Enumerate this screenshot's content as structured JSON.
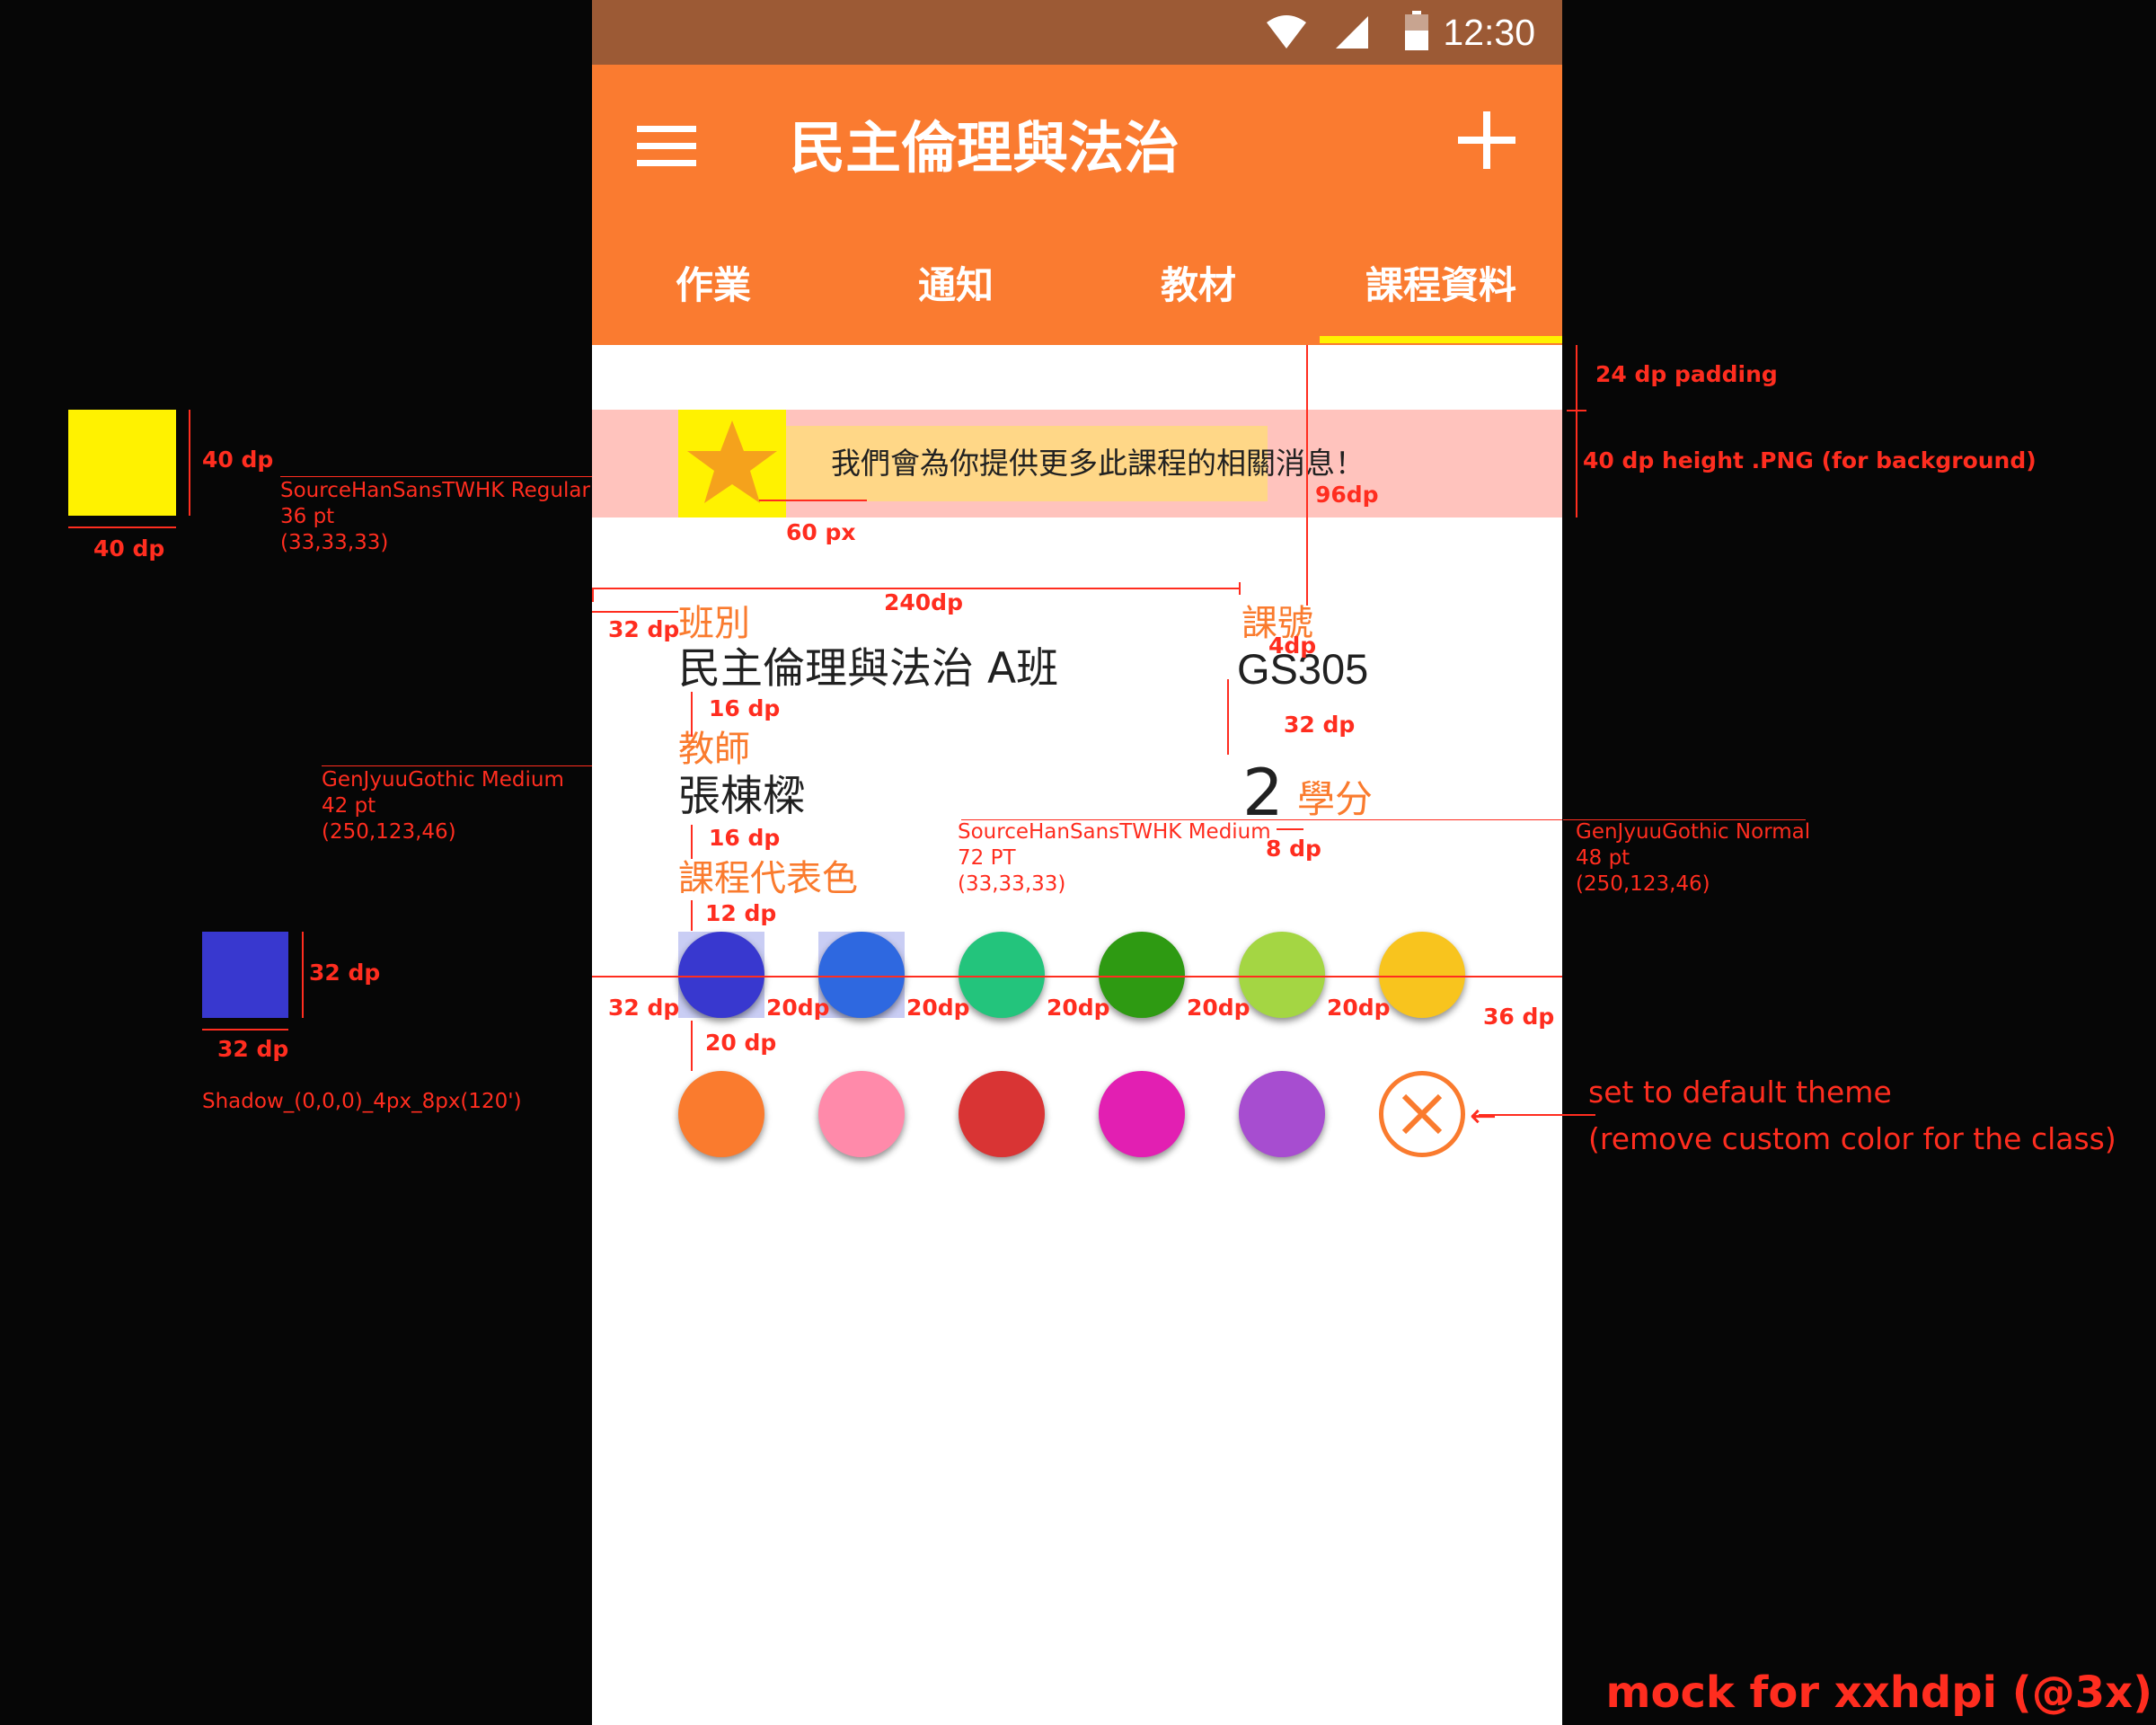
{
  "status_bar": {
    "time": "12:30",
    "icons": [
      "wifi-icon",
      "signal-icon",
      "battery-icon"
    ],
    "background": "#9c5a35"
  },
  "app_bar": {
    "menu_icon": "menu-icon",
    "title": "民主倫理與法治",
    "add_icon": "add-icon",
    "background": "#fa7b30"
  },
  "tabs": [
    {
      "label": "作業",
      "selected": false
    },
    {
      "label": "通知",
      "selected": false
    },
    {
      "label": "教材",
      "selected": false
    },
    {
      "label": "課程資料",
      "selected": true
    }
  ],
  "tab_indicator_color": "#fff200",
  "banner": {
    "icon": "star-icon",
    "text": "我們會為你提供更多此課程的相關消息！",
    "background": "#ffc3bd",
    "badge_color": "#fff200"
  },
  "course": {
    "class_label": "班別",
    "class_value": "民主倫理與法治  A班",
    "code_label": "課號",
    "code_value": "GS305",
    "teacher_label": "教師",
    "teacher_value": "張棟樑",
    "credits_value": "2",
    "credits_unit": "學分",
    "color_label": "課程代表色"
  },
  "color_swatches": [
    "#3838cf",
    "#2e68e0",
    "#23c47c",
    "#2e9a12",
    "#a4d643",
    "#f8c41e",
    "#fa7b2e",
    "#ff8aaa",
    "#d93434",
    "#e21fb2",
    "#a74dd0"
  ],
  "selected_swatches": [
    0,
    1
  ],
  "reset_icon": "close-circle-icon",
  "annotations": {
    "padding_24": "24 dp padding",
    "height_40": "40 dp height .PNG (for background)",
    "dp96": "96dp",
    "px60": "60 px",
    "dp240": "240dp",
    "dp32": "32 dp",
    "dp4": "4dp",
    "dp32_b": "32 dp",
    "dp16": "16 dp",
    "dp16_b": "16 dp",
    "dp12": "12 dp",
    "dp8": "8 dp",
    "dp20": "20dp",
    "dp20_rows": "20 dp",
    "dp36": "36 dp",
    "dp32_row": "32 dp",
    "font_banner": "SourceHanSansTWHK Regular",
    "font_banner_size": "36 pt",
    "font_banner_color": "(33,33,33)",
    "font_label": "GenJyuuGothic Medium",
    "font_label_size": "42 pt",
    "font_label_color": "(250,123,46)",
    "font_number": "SourceHanSansTWHK Medium",
    "font_number_size": "72 PT",
    "font_number_color": "(33,33,33)",
    "font_unit": "GenJyuuGothic Normal",
    "font_unit_size": "48 pt",
    "font_unit_color": "(250,123,46)",
    "sample_yellow_h": "40 dp",
    "sample_yellow_w": "40 dp",
    "sample_blue_h": "32 dp",
    "sample_blue_w": "32 dp",
    "shadow_spec": "Shadow_(0,0,0)_4px_8px(120')",
    "reset_note_1": "set to default theme",
    "reset_note_2": "(remove custom color for the class)",
    "footer": "mock for xxhdpi (@3x)"
  }
}
